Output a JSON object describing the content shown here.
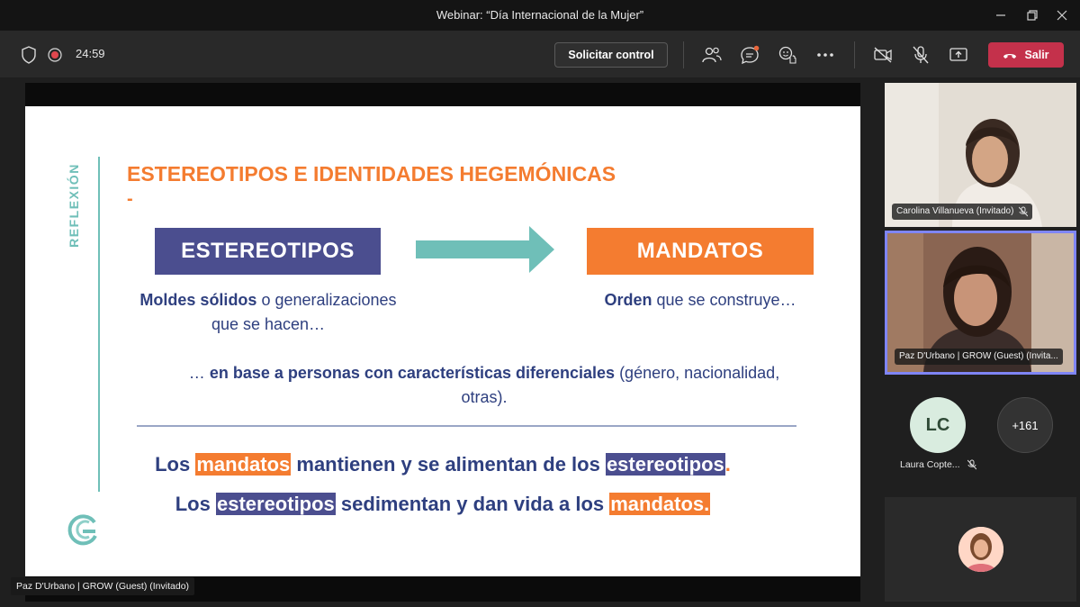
{
  "window": {
    "title": "Webinar: “Día Internacional de la Mujer”"
  },
  "toolbar": {
    "timer": "24:59",
    "request_control_label": "Solicitar control",
    "leave_label": "Salir",
    "leave_color": "#c4314b"
  },
  "slide": {
    "side_label": "REFLEXIÓN",
    "title": "ESTEREOTIPOS E IDENTIDADES HEGEMÓNICAS",
    "title_dash": "-",
    "box_left": "ESTEREOTIPOS",
    "box_right": "MANDATOS",
    "left_caption_bold": "Moldes sólidos",
    "left_caption_rest": " o generalizaciones",
    "left_caption_line2": "que se hacen…",
    "right_caption_bold": "Orden",
    "right_caption_rest": " que se construye…",
    "middle_prefix": "… ",
    "middle_bold": "en base a personas con características diferenciales",
    "middle_rest": " (género, nacionalidad,",
    "middle_line2": "otras).",
    "line1": {
      "a": "Los ",
      "hl1": "mandatos",
      "b": " mantienen y se alimentan de los ",
      "hl2": "estereotipos",
      "c": "."
    },
    "line2": {
      "a": "Los ",
      "hl1": "estereotipos",
      "b": " sedimentan y dan vida a los  ",
      "hl2": "mandatos."
    },
    "colors": {
      "orange": "#f47c30",
      "blue": "#4b4e8f",
      "teal": "#6fbfb8",
      "navy": "#2e3f7f"
    }
  },
  "presenter_tag": "Paz D'Urbano | GROW (Guest) (Invitado)",
  "participants": {
    "tile1_name": "Carolina Villanueva (Invitado)",
    "tile2_name": "Paz D'Urbano | GROW (Guest) (Invita...",
    "lc_initials": "LC",
    "lc_name": "Laura Copte...",
    "more_count": "+161"
  }
}
